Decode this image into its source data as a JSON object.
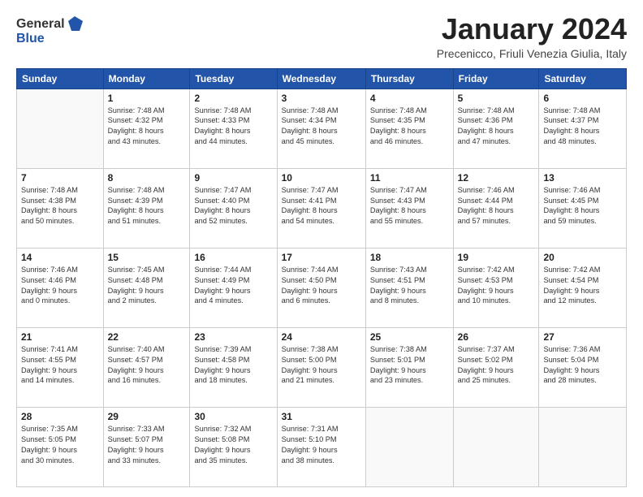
{
  "header": {
    "logo_general": "General",
    "logo_blue": "Blue",
    "month_title": "January 2024",
    "location": "Precenicco, Friuli Venezia Giulia, Italy"
  },
  "days_of_week": [
    "Sunday",
    "Monday",
    "Tuesday",
    "Wednesday",
    "Thursday",
    "Friday",
    "Saturday"
  ],
  "weeks": [
    [
      {
        "day": "",
        "text": ""
      },
      {
        "day": "1",
        "text": "Sunrise: 7:48 AM\nSunset: 4:32 PM\nDaylight: 8 hours\nand 43 minutes."
      },
      {
        "day": "2",
        "text": "Sunrise: 7:48 AM\nSunset: 4:33 PM\nDaylight: 8 hours\nand 44 minutes."
      },
      {
        "day": "3",
        "text": "Sunrise: 7:48 AM\nSunset: 4:34 PM\nDaylight: 8 hours\nand 45 minutes."
      },
      {
        "day": "4",
        "text": "Sunrise: 7:48 AM\nSunset: 4:35 PM\nDaylight: 8 hours\nand 46 minutes."
      },
      {
        "day": "5",
        "text": "Sunrise: 7:48 AM\nSunset: 4:36 PM\nDaylight: 8 hours\nand 47 minutes."
      },
      {
        "day": "6",
        "text": "Sunrise: 7:48 AM\nSunset: 4:37 PM\nDaylight: 8 hours\nand 48 minutes."
      }
    ],
    [
      {
        "day": "7",
        "text": "Sunrise: 7:48 AM\nSunset: 4:38 PM\nDaylight: 8 hours\nand 50 minutes."
      },
      {
        "day": "8",
        "text": "Sunrise: 7:48 AM\nSunset: 4:39 PM\nDaylight: 8 hours\nand 51 minutes."
      },
      {
        "day": "9",
        "text": "Sunrise: 7:47 AM\nSunset: 4:40 PM\nDaylight: 8 hours\nand 52 minutes."
      },
      {
        "day": "10",
        "text": "Sunrise: 7:47 AM\nSunset: 4:41 PM\nDaylight: 8 hours\nand 54 minutes."
      },
      {
        "day": "11",
        "text": "Sunrise: 7:47 AM\nSunset: 4:43 PM\nDaylight: 8 hours\nand 55 minutes."
      },
      {
        "day": "12",
        "text": "Sunrise: 7:46 AM\nSunset: 4:44 PM\nDaylight: 8 hours\nand 57 minutes."
      },
      {
        "day": "13",
        "text": "Sunrise: 7:46 AM\nSunset: 4:45 PM\nDaylight: 8 hours\nand 59 minutes."
      }
    ],
    [
      {
        "day": "14",
        "text": "Sunrise: 7:46 AM\nSunset: 4:46 PM\nDaylight: 9 hours\nand 0 minutes."
      },
      {
        "day": "15",
        "text": "Sunrise: 7:45 AM\nSunset: 4:48 PM\nDaylight: 9 hours\nand 2 minutes."
      },
      {
        "day": "16",
        "text": "Sunrise: 7:44 AM\nSunset: 4:49 PM\nDaylight: 9 hours\nand 4 minutes."
      },
      {
        "day": "17",
        "text": "Sunrise: 7:44 AM\nSunset: 4:50 PM\nDaylight: 9 hours\nand 6 minutes."
      },
      {
        "day": "18",
        "text": "Sunrise: 7:43 AM\nSunset: 4:51 PM\nDaylight: 9 hours\nand 8 minutes."
      },
      {
        "day": "19",
        "text": "Sunrise: 7:42 AM\nSunset: 4:53 PM\nDaylight: 9 hours\nand 10 minutes."
      },
      {
        "day": "20",
        "text": "Sunrise: 7:42 AM\nSunset: 4:54 PM\nDaylight: 9 hours\nand 12 minutes."
      }
    ],
    [
      {
        "day": "21",
        "text": "Sunrise: 7:41 AM\nSunset: 4:55 PM\nDaylight: 9 hours\nand 14 minutes."
      },
      {
        "day": "22",
        "text": "Sunrise: 7:40 AM\nSunset: 4:57 PM\nDaylight: 9 hours\nand 16 minutes."
      },
      {
        "day": "23",
        "text": "Sunrise: 7:39 AM\nSunset: 4:58 PM\nDaylight: 9 hours\nand 18 minutes."
      },
      {
        "day": "24",
        "text": "Sunrise: 7:38 AM\nSunset: 5:00 PM\nDaylight: 9 hours\nand 21 minutes."
      },
      {
        "day": "25",
        "text": "Sunrise: 7:38 AM\nSunset: 5:01 PM\nDaylight: 9 hours\nand 23 minutes."
      },
      {
        "day": "26",
        "text": "Sunrise: 7:37 AM\nSunset: 5:02 PM\nDaylight: 9 hours\nand 25 minutes."
      },
      {
        "day": "27",
        "text": "Sunrise: 7:36 AM\nSunset: 5:04 PM\nDaylight: 9 hours\nand 28 minutes."
      }
    ],
    [
      {
        "day": "28",
        "text": "Sunrise: 7:35 AM\nSunset: 5:05 PM\nDaylight: 9 hours\nand 30 minutes."
      },
      {
        "day": "29",
        "text": "Sunrise: 7:33 AM\nSunset: 5:07 PM\nDaylight: 9 hours\nand 33 minutes."
      },
      {
        "day": "30",
        "text": "Sunrise: 7:32 AM\nSunset: 5:08 PM\nDaylight: 9 hours\nand 35 minutes."
      },
      {
        "day": "31",
        "text": "Sunrise: 7:31 AM\nSunset: 5:10 PM\nDaylight: 9 hours\nand 38 minutes."
      },
      {
        "day": "",
        "text": ""
      },
      {
        "day": "",
        "text": ""
      },
      {
        "day": "",
        "text": ""
      }
    ]
  ]
}
